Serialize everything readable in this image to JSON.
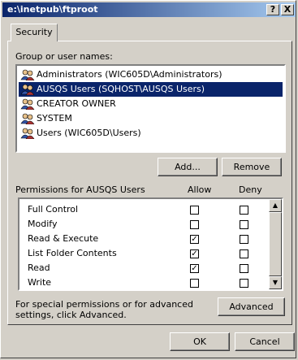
{
  "window": {
    "title": "e:\\inetpub\\ftproot",
    "help_label": "?",
    "close_label": "X"
  },
  "tabs": [
    {
      "label": "Security",
      "selected": true
    }
  ],
  "group": {
    "label": "Group or user names:",
    "items": [
      {
        "label": "Administrators (WIC605D\\Administrators)",
        "selected": false
      },
      {
        "label": "AUSQS Users (SQHOST\\AUSQS Users)",
        "selected": true
      },
      {
        "label": "CREATOR OWNER",
        "selected": false
      },
      {
        "label": "SYSTEM",
        "selected": false
      },
      {
        "label": "Users (WIC605D\\Users)",
        "selected": false
      }
    ]
  },
  "buttons": {
    "add": "Add...",
    "remove": "Remove",
    "advanced": "Advanced",
    "ok": "OK",
    "cancel": "Cancel"
  },
  "permissions": {
    "label": "Permissions for AUSQS Users",
    "allow_header": "Allow",
    "deny_header": "Deny",
    "rows": [
      {
        "name": "Full Control",
        "allow": false,
        "deny": false
      },
      {
        "name": "Modify",
        "allow": false,
        "deny": false
      },
      {
        "name": "Read & Execute",
        "allow": true,
        "deny": false
      },
      {
        "name": "List Folder Contents",
        "allow": true,
        "deny": false
      },
      {
        "name": "Read",
        "allow": true,
        "deny": false
      },
      {
        "name": "Write",
        "allow": false,
        "deny": false
      }
    ]
  },
  "advanced_note": "For special permissions or for advanced settings, click Advanced.",
  "icons": {
    "user": "users-icon",
    "check": "✓",
    "scroll_up": "▲",
    "scroll_down": "▼"
  },
  "colors": {
    "selection": "#0a246a",
    "title_start": "#0a246a",
    "title_end": "#a6caf0",
    "face": "#d4d0c8"
  }
}
